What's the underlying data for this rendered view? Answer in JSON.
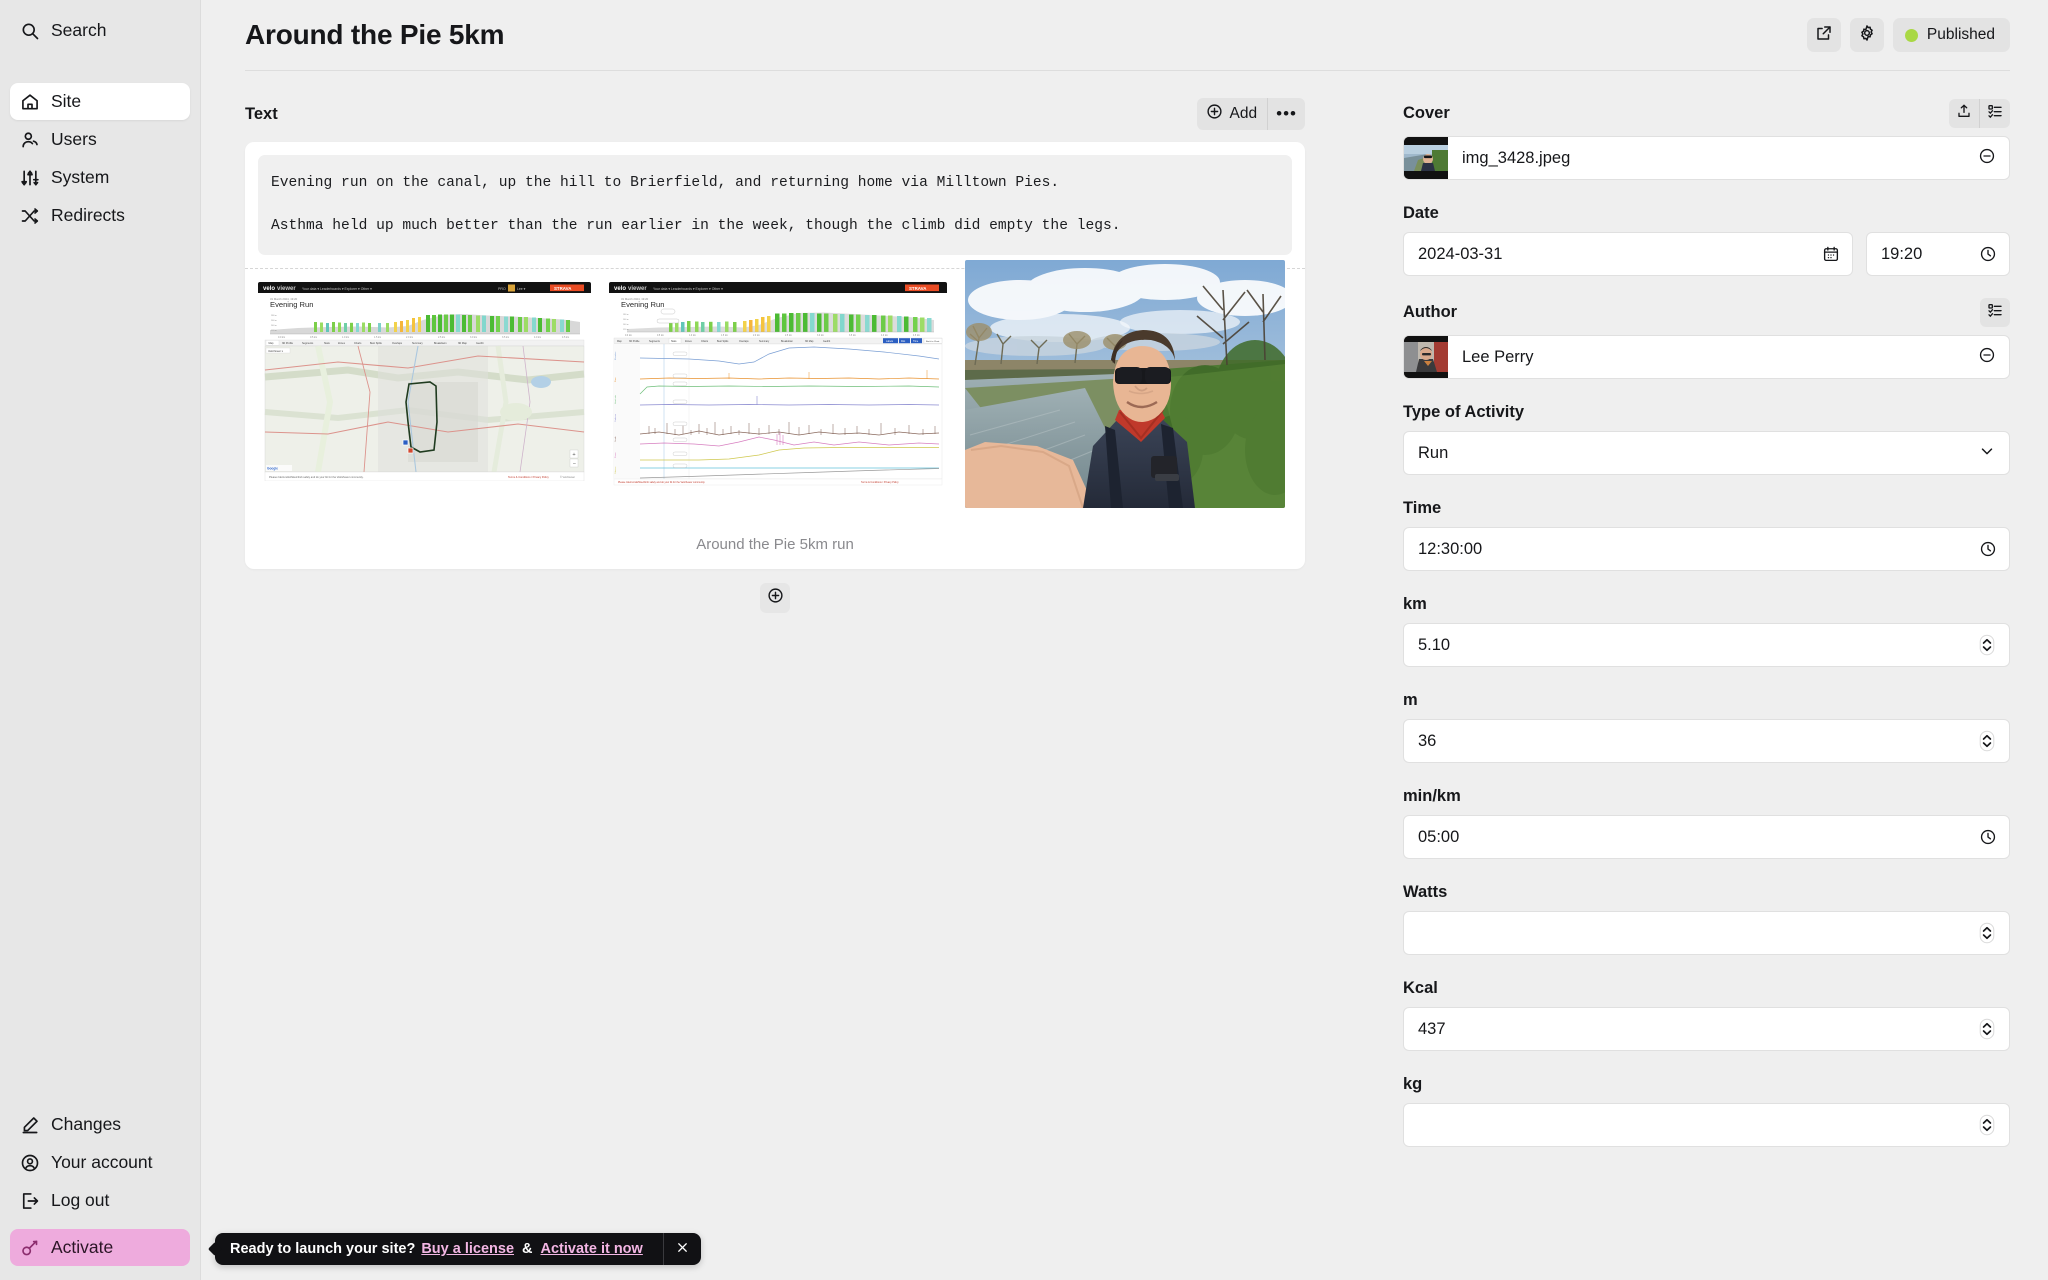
{
  "sidebar": {
    "search": {
      "label": "Search",
      "icon": "search-icon"
    },
    "items": [
      {
        "label": "Site",
        "icon": "home-icon",
        "active": true
      },
      {
        "label": "Users",
        "icon": "users-icon",
        "active": false
      },
      {
        "label": "System",
        "icon": "sliders-icon",
        "active": false
      },
      {
        "label": "Redirects",
        "icon": "shuffle-icon",
        "active": false
      }
    ],
    "bottom_items": [
      {
        "label": "Changes",
        "icon": "pencil-icon"
      },
      {
        "label": "Your account",
        "icon": "user-circle-icon"
      },
      {
        "label": "Log out",
        "icon": "logout-icon"
      }
    ],
    "activate": {
      "label": "Activate",
      "icon": "key-icon",
      "color": "#eeabdd"
    }
  },
  "header": {
    "title": "Around the Pie 5km",
    "preview_icon": "external-link-icon",
    "settings_icon": "gear-icon",
    "status": {
      "label": "Published",
      "dot_color": "#a9d844"
    }
  },
  "main": {
    "section_title": "Text",
    "add_label": "Add",
    "add_icon": "plus-circle-icon",
    "more_icon": "ellipsis-icon",
    "text_block": {
      "paragraph_1": "Evening run on the canal, up the hill to Brierfield, and returning home via Milltown Pies.",
      "paragraph_2": "Asthma held up much better than the run earlier in the week, though the climb did empty the legs."
    },
    "gallery": {
      "caption": "Around the Pie 5km run",
      "images": [
        {
          "alt": "VeloViewer Evening Run map with route and elevation profile"
        },
        {
          "alt": "VeloViewer Evening Run data charts with multiple metric traces"
        },
        {
          "alt": "Selfie of runner beside a canal with trees and cloudy sky"
        }
      ]
    },
    "add_block_icon": "plus-circle-icon"
  },
  "panel": {
    "cover": {
      "label": "Cover",
      "upload_icon": "upload-icon",
      "select_icon": "list-select-icon",
      "filename": "img_3428.jpeg",
      "remove_icon": "minus-circle-icon"
    },
    "date": {
      "label": "Date",
      "value": "2024-03-31",
      "calendar_icon": "calendar-icon",
      "time_value": "19:20",
      "clock_icon": "clock-icon"
    },
    "author": {
      "label": "Author",
      "select_icon": "list-select-icon",
      "name": "Lee Perry",
      "remove_icon": "minus-circle-icon"
    },
    "activity": {
      "label": "Type of Activity",
      "value": "Run",
      "chevron_icon": "chevron-down-icon"
    },
    "fields": [
      {
        "label": "Time",
        "value": "12:30:00",
        "control": "clock-icon"
      },
      {
        "label": "km",
        "value": "5.10",
        "control": "stepper-icon"
      },
      {
        "label": "m",
        "value": "36",
        "control": "stepper-icon"
      },
      {
        "label": "min/km",
        "value": "05:00",
        "control": "clock-icon"
      },
      {
        "label": "Watts",
        "value": "",
        "control": "stepper-icon"
      },
      {
        "label": "Kcal",
        "value": "437",
        "control": "stepper-icon"
      },
      {
        "label": "kg",
        "value": "",
        "control": "stepper-icon"
      }
    ]
  },
  "banner": {
    "message": "Ready to launch your site?",
    "link_1": "Buy a license",
    "separator": "&",
    "link_2": "Activate it now",
    "close_icon": "close-icon",
    "link_color": "#f3b6e4"
  }
}
